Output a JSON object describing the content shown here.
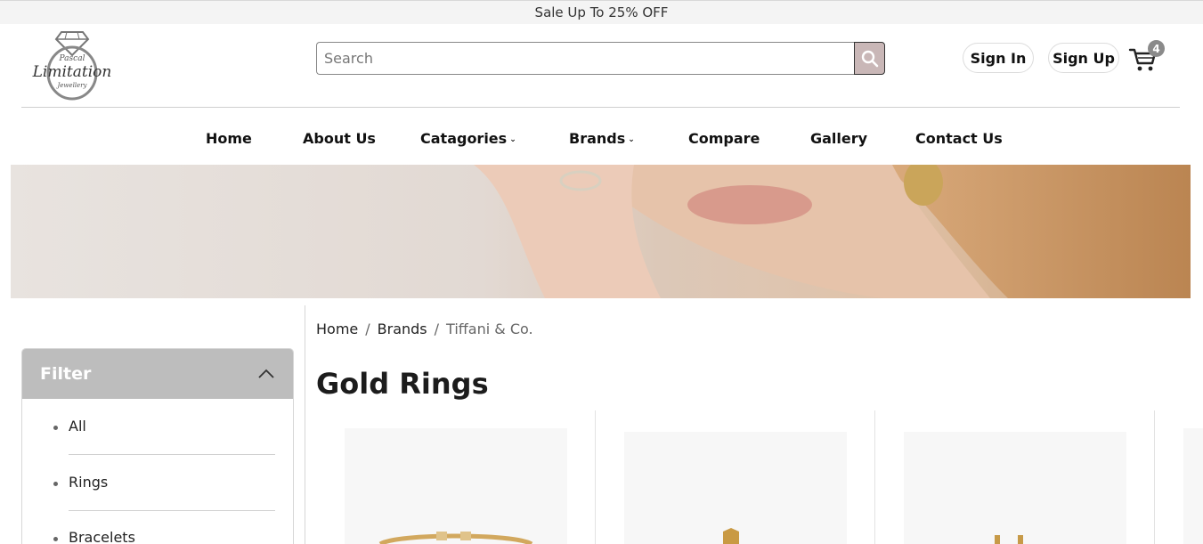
{
  "promo": {
    "text": "Sale Up To 25% OFF"
  },
  "logo": {
    "line1": "Pascal",
    "line2": "Limitation",
    "line3": "Jewellery"
  },
  "search": {
    "placeholder": "Search"
  },
  "account": {
    "sign_in": "Sign In",
    "sign_up": "Sign Up",
    "cart_count": "4"
  },
  "nav": {
    "items": [
      {
        "label": "Home"
      },
      {
        "label": "About Us"
      },
      {
        "label": "Catagories"
      },
      {
        "label": "Brands"
      },
      {
        "label": "Compare"
      },
      {
        "label": "Gallery"
      },
      {
        "label": "Contact Us"
      }
    ]
  },
  "breadcrumb": {
    "home": "Home",
    "brands": "Brands",
    "current": "Tiffani & Co."
  },
  "page": {
    "title": "Gold Rings"
  },
  "filter": {
    "title": "Filter",
    "items": [
      "All",
      "Rings",
      "Bracelets"
    ]
  },
  "colors": {
    "accent": "#bdbdbd",
    "search_button": "#c9b7b7"
  }
}
